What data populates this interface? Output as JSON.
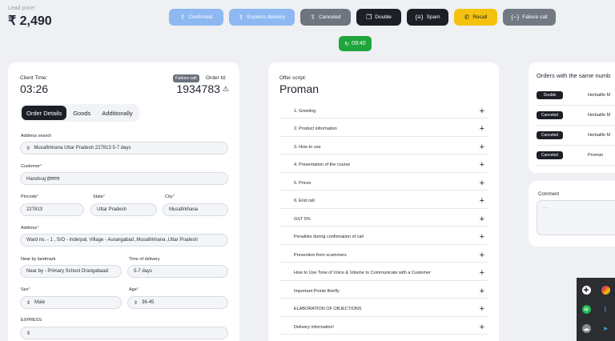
{
  "header": {
    "lead_price_label": "Lead price:",
    "lead_price_value": "₹ 2,490",
    "actions": {
      "confirmed": "Confirmed",
      "express": "Express delivery",
      "canceled": "Canceled",
      "double": "Double",
      "spam": "Spam",
      "recall": "Recall",
      "failure": "Failure call"
    },
    "timer": "09:40"
  },
  "client": {
    "time_label": "Client Time:",
    "time_value": "03:26",
    "status_badge": "Failure call",
    "order_id_label": "Order Id:",
    "order_id_value": "1934783",
    "tabs": [
      "Order Details",
      "Goods",
      "Additionally"
    ],
    "fields": {
      "address_search_label": "Address search",
      "address_search_value": "Musafirkhana Uttar Pradesh 227813 5-7 days",
      "customer_label": "Customer",
      "customer_value": "Hanshraj हंसराज",
      "pincode_label": "Pincode",
      "pincode_value": "227813",
      "state_label": "State",
      "state_value": "Uttar Pradesh",
      "city_label": "City",
      "city_value": "Musafirkhana",
      "address_label": "Address",
      "address_value": "Ward no. - 1 , S/O - Inderpal, Village - Aurangabad ,Musafirkhana ,Uttar Pradesh",
      "landmark_label": "Near by landmark",
      "landmark_value": "Near by - Primary School Orangabaad",
      "delivery_label": "Time of delivery",
      "delivery_value": "5-7 days",
      "sex_label": "Sex",
      "sex_value": "Male",
      "age_label": "Age",
      "age_value": "36-45",
      "express_label": "EXPRESS",
      "express_value": ""
    }
  },
  "offer": {
    "label": "Offer script:",
    "value": "Proman",
    "sections": [
      "1. Greeting",
      "2. Product information",
      "3. How to use",
      "4. Presentation of the course",
      "5. Prices",
      "6. End call",
      "GST 5%",
      "Penalties during confirmation of call",
      "Prevention from scammers",
      "How to Use Tone of Voice & Volume to Communicate with a Customer",
      "Important Points Briefly",
      "ELABORATION OF OBJECTIONS",
      "Delivery information!"
    ]
  },
  "orders": {
    "title": "Orders with the same numb",
    "rows": [
      {
        "status": "Double",
        "product": "Herbalife M"
      },
      {
        "status": "Canceled",
        "product": "Herbalife M"
      },
      {
        "status": "Canceled",
        "product": "Herbalife M"
      },
      {
        "status": "Canceled",
        "product": "Proman"
      }
    ]
  },
  "comment": {
    "label": "Comment",
    "placeholder": "..."
  }
}
